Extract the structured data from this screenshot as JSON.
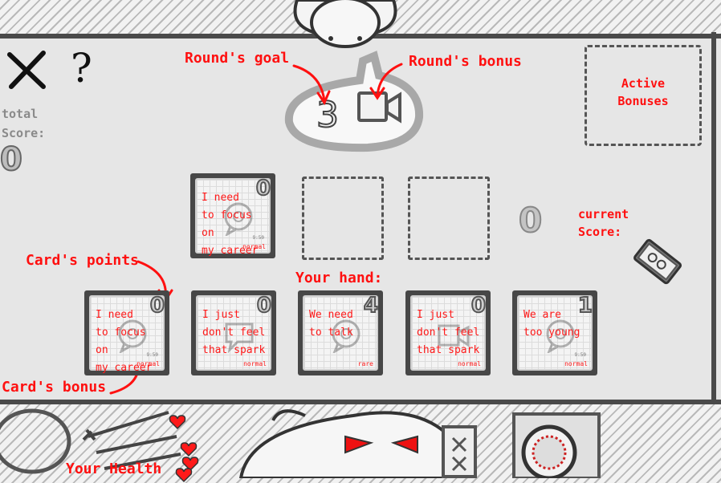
{
  "header": {
    "close_label": "✕",
    "help_label": "?"
  },
  "score": {
    "total_label_line1": "total",
    "total_label_line2": "Score:",
    "total_value": "0",
    "current_value": "0"
  },
  "round": {
    "goal_value": "3",
    "bonus_icon": "video-camera-icon"
  },
  "annotations": {
    "rounds_goal": "Round's goal",
    "rounds_bonus": "Round's bonus",
    "active_bonuses_line1": "Active",
    "active_bonuses_line2": "Bonuses",
    "current_score_line1": "current",
    "current_score_line2": "Score:",
    "cards_points": "Card's points",
    "your_hand": "Your hand:",
    "cards_bonus": "Card's bonus",
    "your_health": "Your Health"
  },
  "played_cards": [
    {
      "text": "I need\nto focus on\nmy career",
      "points": "0",
      "rarity": "normal",
      "time": "9:50",
      "icon": "chat-bubble-icon"
    }
  ],
  "hand": [
    {
      "text": "I need\nto focus on\nmy career",
      "points": "0",
      "rarity": "normal",
      "time": "9:50",
      "icon": "chat-bubble-icon"
    },
    {
      "text": "I just\ndon't feel\nthat spark",
      "points": "0",
      "rarity": "normal",
      "icon": "speech-bubble-icon"
    },
    {
      "text": "We need\nto talk",
      "points": "4",
      "rarity": "rare",
      "icon": "chat-bubble-icon"
    },
    {
      "text": "I just\ndon't feel\nthat spark",
      "points": "0",
      "rarity": "normal",
      "icon": "video-camera-icon"
    },
    {
      "text": "We are\ntoo young",
      "points": "1",
      "rarity": "normal",
      "time": "9:50",
      "icon": "chat-bubble-icon"
    }
  ],
  "health": {
    "hearts": 4
  },
  "colors": {
    "annotation": "#ff1010",
    "card_border": "#474747",
    "heart": "#ff1a1a"
  }
}
